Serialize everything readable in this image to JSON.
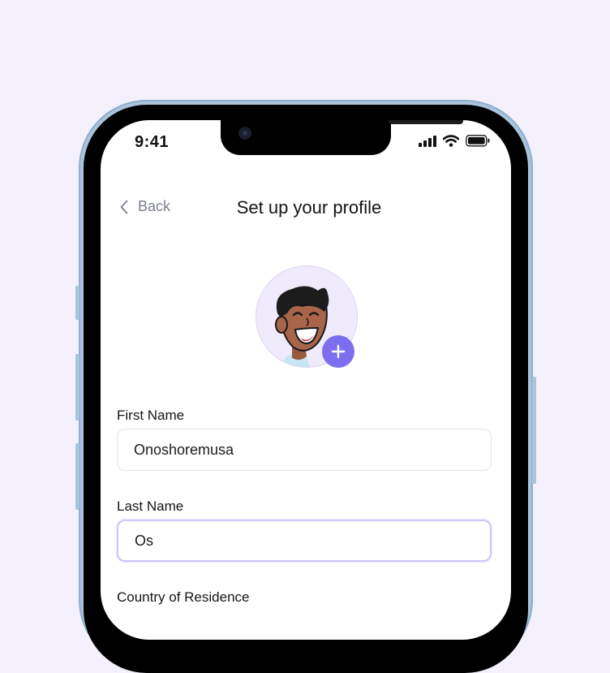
{
  "status_bar": {
    "time": "9:41"
  },
  "nav": {
    "back_label": "Back",
    "title": "Set up your profile"
  },
  "form": {
    "first_name": {
      "label": "First Name",
      "value": "Onoshoremusa"
    },
    "last_name": {
      "label": "Last Name",
      "value": "Os"
    },
    "country": {
      "label": "Country of Residence"
    }
  },
  "colors": {
    "background": "#f4f1fd",
    "accent": "#7d6ef0",
    "avatar_bg": "#efeafc",
    "phone_frame": "#a9c4dc"
  },
  "icons": [
    "chevron-left-icon",
    "signal-icon",
    "wifi-icon",
    "battery-icon",
    "plus-icon"
  ]
}
